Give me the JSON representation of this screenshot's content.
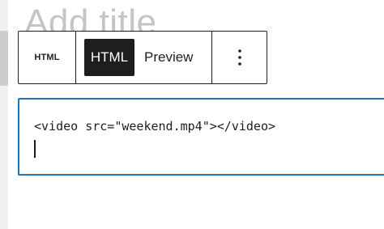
{
  "page": {
    "ghost_title": "Add title"
  },
  "toolbar": {
    "block_type_label": "HTML",
    "mode_html_label": "HTML",
    "mode_preview_label": "Preview",
    "more_icon": "more-vertical-icon"
  },
  "editor": {
    "code": "<video src=\"weekend.mp4\"></video>"
  },
  "colors": {
    "accent": "#2271b1",
    "toolbar_border": "#1e1e1e",
    "active_bg": "#1e1e1e",
    "ghost_text": "#c3c4c7"
  }
}
